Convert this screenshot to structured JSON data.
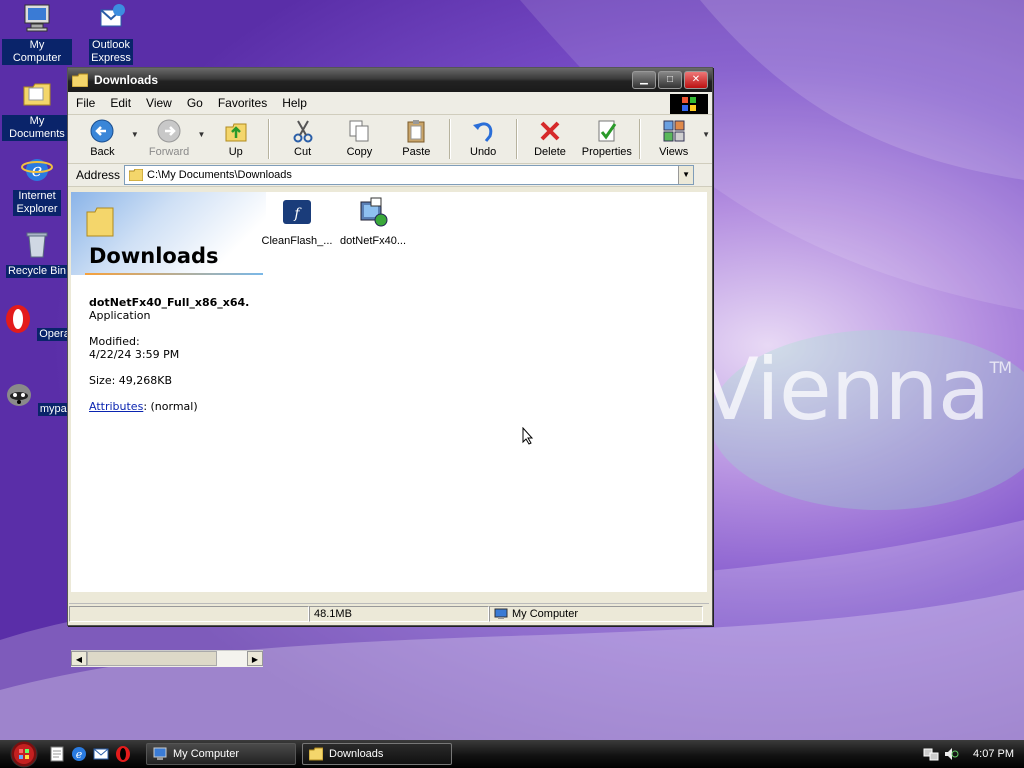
{
  "desktop": {
    "icons": [
      {
        "label": "My Computer"
      },
      {
        "label": "Outlook Express"
      },
      {
        "label": "My Documents"
      },
      {
        "label": "Internet Explorer"
      },
      {
        "label": "Recycle Bin"
      },
      {
        "label": "Opera"
      },
      {
        "label": "mypal"
      }
    ],
    "wallpaper_text": "Vienna",
    "wallpaper_tm": "TM"
  },
  "window": {
    "title": "Downloads",
    "menu": [
      "File",
      "Edit",
      "View",
      "Go",
      "Favorites",
      "Help"
    ],
    "toolbar": {
      "back": "Back",
      "forward": "Forward",
      "up": "Up",
      "cut": "Cut",
      "copy": "Copy",
      "paste": "Paste",
      "undo": "Undo",
      "delete": "Delete",
      "properties": "Properties",
      "views": "Views"
    },
    "address": {
      "label": "Address",
      "value": "C:\\My Documents\\Downloads"
    },
    "webview": {
      "folder_title": "Downloads",
      "selected_name": "dotNetFx40_Full_x86_x64.",
      "selected_type": "Application",
      "modified_label": "Modified:",
      "modified_value": "4/22/24 3:59 PM",
      "size": "Size: 49,268KB",
      "attributes_link": "Attributes",
      "attributes_value": ": (normal)"
    },
    "files": [
      {
        "name": "CleanFlash_..."
      },
      {
        "name": "dotNetFx40..."
      }
    ],
    "status": {
      "size": "48.1MB",
      "zone": "My Computer"
    }
  },
  "taskbar": {
    "tasks": [
      {
        "label": "My Computer"
      },
      {
        "label": "Downloads"
      }
    ],
    "clock": "4:07 PM"
  }
}
